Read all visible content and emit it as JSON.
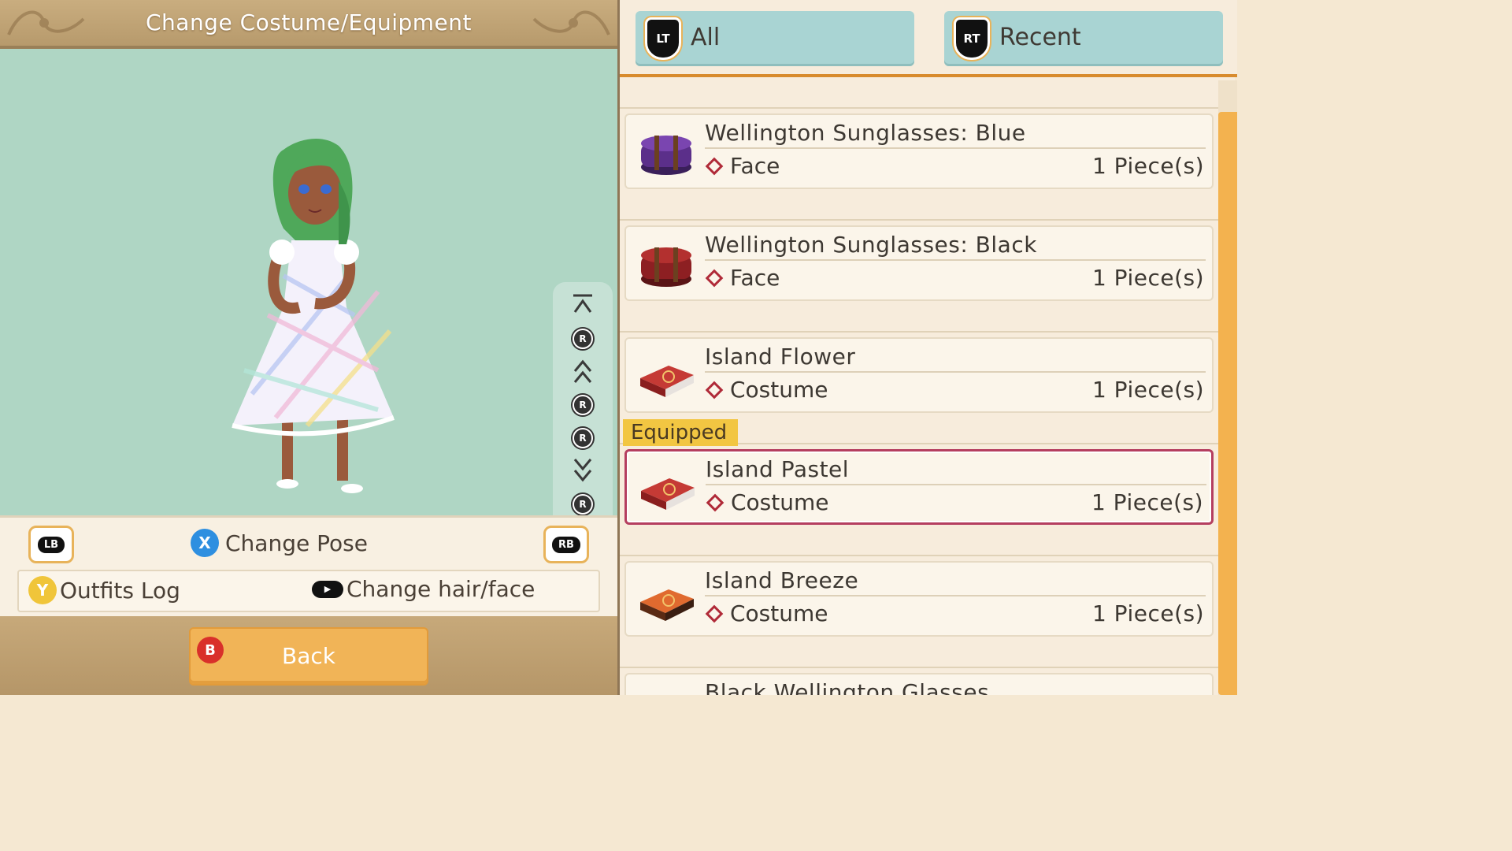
{
  "header": {
    "title": "Change Costume/Equipment"
  },
  "camera_controls": [
    "top-arrow-icon",
    "rstick-up-icon",
    "up-double-arrow-icon",
    "rstick-left-icon",
    "rstick-right-icon",
    "down-double-arrow-icon",
    "rstick-down-icon",
    "bottom-arrow-icon"
  ],
  "controls": {
    "lb_label": "LB",
    "rb_label": "RB",
    "x_label": "X",
    "pose_label": "Change Pose",
    "y_label": "Y",
    "outfits_label": "Outfits Log",
    "hairface_label": "Change hair/face"
  },
  "back": {
    "b_label": "B",
    "label": "Back"
  },
  "tabs": [
    {
      "key": "LT",
      "label": "All"
    },
    {
      "key": "RT",
      "label": "Recent"
    }
  ],
  "items": [
    {
      "name": "Wellington Sunglasses: Blue",
      "category": "Face",
      "qty": "1 Piece(s)",
      "icon": "purple-case-icon",
      "color": "#5b2f8a",
      "equipped": false
    },
    {
      "name": "Wellington Sunglasses: Black",
      "category": "Face",
      "qty": "1 Piece(s)",
      "icon": "red-case-icon",
      "color": "#8d1f22",
      "equipped": false
    },
    {
      "name": "Island Flower",
      "category": "Costume",
      "qty": "1 Piece(s)",
      "icon": "red-suitcase-icon",
      "color": "#a2272b",
      "equipped": false
    },
    {
      "name": "Island Pastel",
      "category": "Costume",
      "qty": "1 Piece(s)",
      "icon": "red-suitcase-icon",
      "color": "#a2272b",
      "equipped": true
    },
    {
      "name": "Island Breeze",
      "category": "Costume",
      "qty": "1 Piece(s)",
      "icon": "orange-suitcase-icon",
      "color": "#c8481f",
      "equipped": false
    },
    {
      "name": "Black Wellington Glasses",
      "category": "",
      "qty": "",
      "icon": "",
      "color": "",
      "equipped": false
    }
  ],
  "equipped_tag": "Equipped",
  "colors": {
    "accent": "#f3b24f",
    "stage": "#afd6c4",
    "tab": "#a9d4d3",
    "equipped_border": "#b53e5f"
  }
}
